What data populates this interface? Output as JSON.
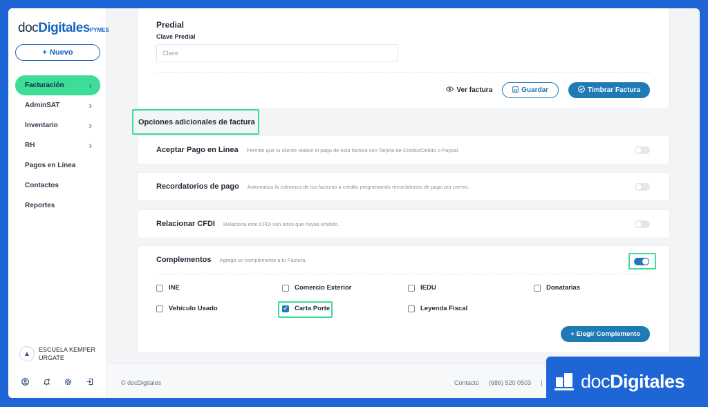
{
  "sidebar": {
    "logo": {
      "prefix": "doc",
      "main": "Digitales",
      "suffix": "PYMES"
    },
    "new_button": "Nuevo",
    "nav": [
      {
        "label": "Facturación",
        "chevron": true,
        "active": true
      },
      {
        "label": "AdminSAT",
        "chevron": true
      },
      {
        "label": "Inventario",
        "chevron": true
      },
      {
        "label": "RH",
        "chevron": true
      },
      {
        "label": "Pagos en Línea",
        "chevron": false
      },
      {
        "label": "Contactos",
        "chevron": false
      },
      {
        "label": "Reportes",
        "chevron": false
      }
    ],
    "user": {
      "name": "ESCUELA KEMPER URGATE"
    },
    "bottom_icons": [
      "user-icon",
      "bell-icon",
      "gear-icon",
      "logout-icon"
    ]
  },
  "predial": {
    "heading": "Predial",
    "field_label": "Clave Predial",
    "placeholder": "Clave"
  },
  "actions": {
    "view": "Ver factura",
    "save": "Guardar",
    "stamp": "Timbrar Factura"
  },
  "section_title": "Opciones adicionales de factura",
  "options": [
    {
      "title": "Aceptar Pago en Linea",
      "desc": "Permite que tu cliente realice el pago de esta factura con Tarjeta de Credito/Debito o Paypal.",
      "enabled": false
    },
    {
      "title": "Recordatorios de pago",
      "desc": "Automatiza la cobranza de tus facturas a crédito programando recordatorios de pago por correo.",
      "enabled": false
    },
    {
      "title": "Relacionar CFDI",
      "desc": "Relaciona este CFDI con otros que hayas emitido.",
      "enabled": false
    }
  ],
  "complementos": {
    "title": "Complementos",
    "desc": "Agrega un complemento a tu Factura.",
    "enabled": true,
    "items": [
      {
        "label": "INE",
        "checked": false
      },
      {
        "label": "Comercio Exterior",
        "checked": false
      },
      {
        "label": "IEDU",
        "checked": false
      },
      {
        "label": "Donatarias",
        "checked": false
      },
      {
        "label": "Vehículo Usado",
        "checked": false
      },
      {
        "label": "Carta Porte",
        "checked": true
      },
      {
        "label": "Leyenda Fiscal",
        "checked": false
      }
    ],
    "button": "Elegir Complemento"
  },
  "footer": {
    "copyright": "© docDigitales",
    "contact_label": "Contacto",
    "phone": "(686) 520 0503",
    "separator": "|"
  },
  "brand_badge": {
    "prefix": "doc",
    "main": "Digitales"
  },
  "colors": {
    "accent": "#1f7ab5",
    "highlight": "#3ddc97",
    "frame": "#1e66d6"
  }
}
